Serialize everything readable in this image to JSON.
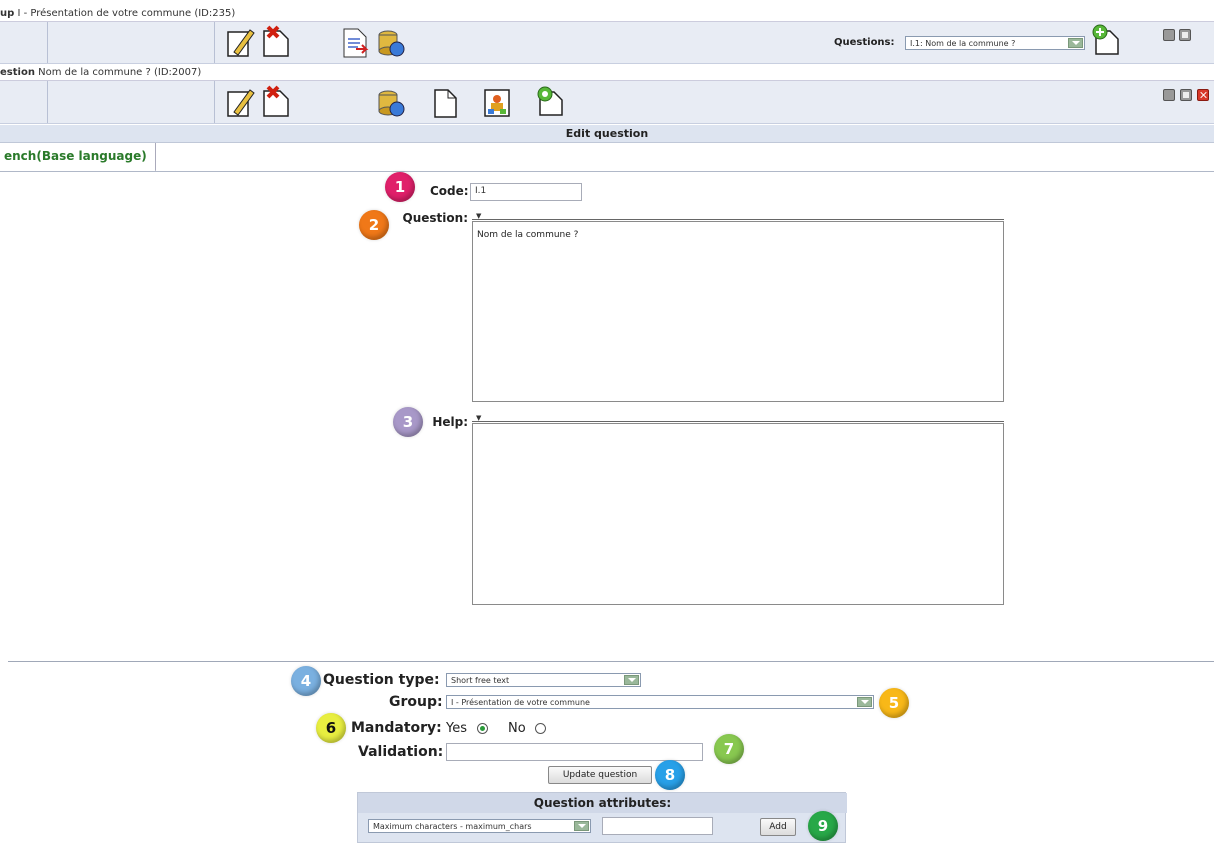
{
  "group_bar": {
    "prefix": "up",
    "title": "I - Présentation de votre commune (ID:235)"
  },
  "group_toolbar": {
    "questions_label": "Questions:",
    "questions_selected": "I.1: Nom de la commune ?",
    "icons": [
      "edit-group-icon",
      "delete-group-icon",
      "export-group-icon",
      "reorder-group-icon",
      "add-question-icon"
    ]
  },
  "question_bar": {
    "prefix": "estion",
    "title": "Nom de la commune ? (ID:2007)"
  },
  "question_toolbar": {
    "icons": [
      "edit-question-icon",
      "delete-question-icon",
      "export-question-icon",
      "copy-question-icon",
      "conditions-icon",
      "answers-icon"
    ]
  },
  "section_header": "Edit question",
  "language_tab": "ench(Base language)",
  "form": {
    "code_label": "Code:",
    "code_value": "I.1",
    "question_label": "Question:",
    "question_text": "Nom de la commune ?",
    "help_label": "Help:",
    "help_text": "",
    "question_type_label": "Question type:",
    "question_type_value": "Short free text",
    "group_label": "Group:",
    "group_value": "I - Présentation de votre commune",
    "mandatory_label": "Mandatory:",
    "mandatory_yes": "Yes",
    "mandatory_no": "No",
    "mandatory_selected": "Yes",
    "validation_label": "Validation:",
    "validation_value": "",
    "update_button": "Update question"
  },
  "attributes": {
    "title": "Question attributes:",
    "select_value": "Maximum characters - maximum_chars",
    "input_value": "",
    "add_button": "Add"
  },
  "badges": [
    {
      "n": "1",
      "color": "#e0206a"
    },
    {
      "n": "2",
      "color": "#f07818"
    },
    {
      "n": "3",
      "color": "#a898c8"
    },
    {
      "n": "4",
      "color": "#7ab0e0"
    },
    {
      "n": "5",
      "color": "#f8b818"
    },
    {
      "n": "6",
      "color": "#e8ee40"
    },
    {
      "n": "7",
      "color": "#88c850"
    },
    {
      "n": "8",
      "color": "#28a0e8"
    },
    {
      "n": "9",
      "color": "#28a848"
    }
  ]
}
